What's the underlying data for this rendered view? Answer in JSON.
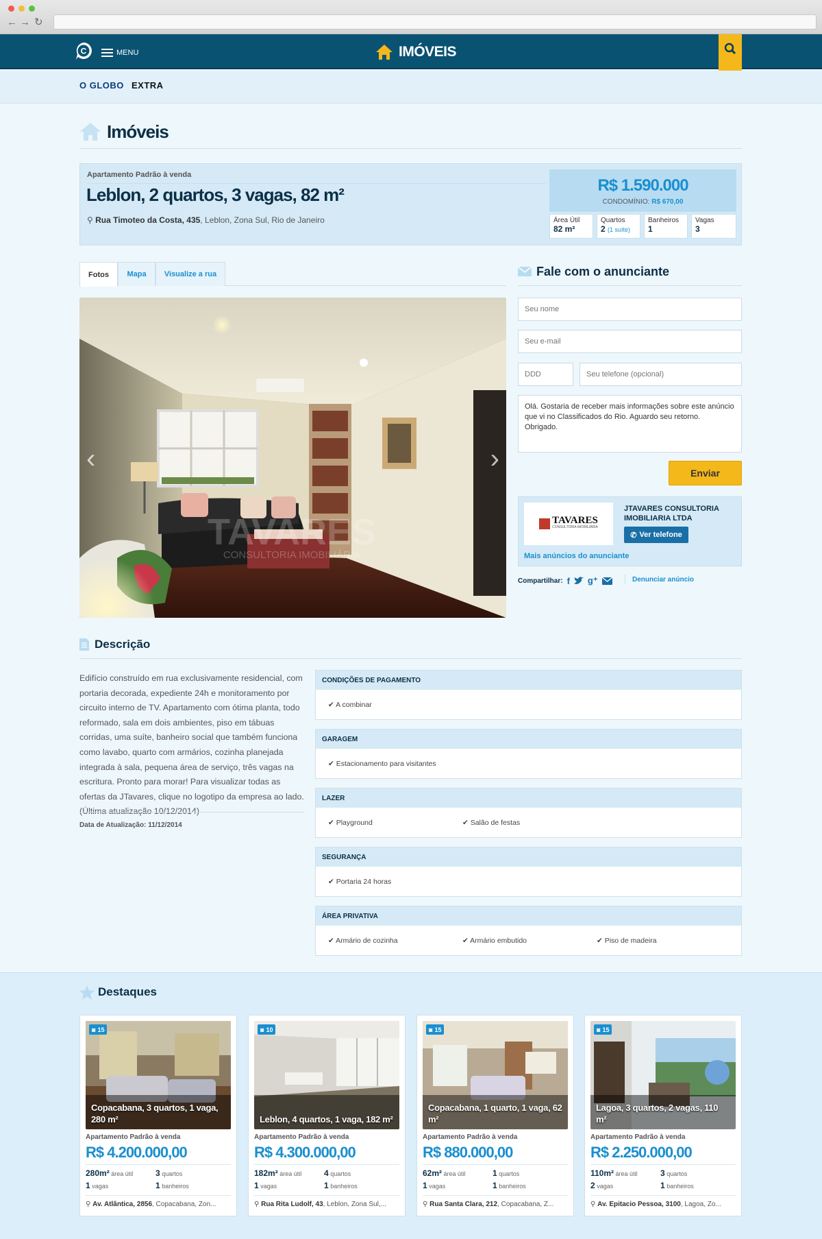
{
  "site": {
    "title": "IMÓVEIS",
    "menu_label": "MENU",
    "brands": [
      "O GLOBO",
      "EXTRA"
    ]
  },
  "section_title": "Imóveis",
  "listing": {
    "type": "Apartamento Padrão à venda",
    "title": "Leblon, 2 quartos, 3 vagas, 82 m²",
    "address_street": "Rua Timoteo da Costa, 435",
    "address_rest": ", Leblon, Zona Sul, Rio de Janeiro",
    "price": "R$ 1.590.000",
    "condo_label": "CONDOMÍNIO:",
    "condo_value": "R$ 670,00",
    "stats": [
      {
        "label": "Área Útil",
        "value": "82 m²",
        "extra": ""
      },
      {
        "label": "Quartos",
        "value": "2",
        "extra": "(1 suíte)"
      },
      {
        "label": "Banheiros",
        "value": "1",
        "extra": ""
      },
      {
        "label": "Vagas",
        "value": "3",
        "extra": ""
      }
    ]
  },
  "tabs": [
    "Fotos",
    "Mapa",
    "Visualize a rua"
  ],
  "photo": {
    "watermark_line1": "TAVARES",
    "watermark_line2": "CONSULTORIA IMOBILIÁRIA"
  },
  "contact": {
    "title": "Fale com o anunciante",
    "name_placeholder": "Seu nome",
    "email_placeholder": "Seu e-mail",
    "ddd_placeholder": "DDD",
    "phone_placeholder": "Seu telefone (opcional)",
    "message": "Olá. Gostaria de receber mais informações sobre este anúncio que vi no Classificados do Rio. Aguardo seu retorno. Obrigado.",
    "send_label": "Enviar"
  },
  "advertiser": {
    "name": "JTAVARES CONSULTORIA IMOBILIARIA LTDA",
    "logo_text": "TAVARES",
    "logo_sub": "CONSULTORIA IMOBILIÁRIA",
    "phone_label": "Ver telefone",
    "more_label": "Mais anúncios do anunciante"
  },
  "share": {
    "label": "Compartilhar:",
    "report_label": "Denunciar anúncio"
  },
  "description": {
    "title": "Descrição",
    "text": "Edifício construído em rua exclusivamente residencial, com portaria decorada, expediente 24h e monitoramento por circuito interno de TV. Apartamento com ótima planta, todo reformado, sala em dois ambientes, piso em tábuas corridas, uma suíte, banheiro social que também funciona como lavabo, quarto com armários, cozinha planejada integrada à sala, pequena área de serviço, três vagas na escritura. Pronto para morar! Para visualizar todas as ofertas da JTavares, clique no logotipo da empresa ao lado. (Última atualização 10/12/2014)",
    "updated": "Data de Atualização: 11/12/2014"
  },
  "features": [
    {
      "title": "CONDIÇÕES DE PAGAMENTO",
      "items": [
        "A combinar"
      ]
    },
    {
      "title": "GARAGEM",
      "items": [
        "Estacionamento para visitantes"
      ]
    },
    {
      "title": "LAZER",
      "items": [
        "Playground",
        "Salão de festas"
      ]
    },
    {
      "title": "SEGURANÇA",
      "items": [
        "Portaria 24 horas"
      ]
    },
    {
      "title": "ÁREA PRIVATIVA",
      "items": [
        "Armário de cozinha",
        "Armário embutido",
        "Piso de madeira"
      ]
    }
  ],
  "destaques": {
    "title": "Destaques",
    "cards": [
      {
        "photos": "15",
        "title": "Copacabana, 3 quartos, 1 vaga, 280 m²",
        "type": "Apartamento Padrão à venda",
        "price": "R$ 4.200.000,00",
        "area": "280m²",
        "area_label": "área útil",
        "rooms": "3",
        "rooms_label": "quartos",
        "spots": "1",
        "spots_label": "vagas",
        "baths": "1",
        "baths_label": "banheiros",
        "street": "Av. Atlântica, 2856",
        "rest": ", Copacabana, Zon..."
      },
      {
        "photos": "10",
        "title": "Leblon, 4 quartos, 1 vaga, 182 m²",
        "type": "Apartamento Padrão à venda",
        "price": "R$ 4.300.000,00",
        "area": "182m²",
        "area_label": "área útil",
        "rooms": "4",
        "rooms_label": "quartos",
        "spots": "1",
        "spots_label": "vagas",
        "baths": "1",
        "baths_label": "banheiros",
        "street": "Rua Rita Ludolf, 43",
        "rest": ", Leblon, Zona Sul,..."
      },
      {
        "photos": "15",
        "title": "Copacabana, 1 quarto, 1 vaga, 62 m²",
        "type": "Apartamento Padrão à venda",
        "price": "R$ 880.000,00",
        "area": "62m²",
        "area_label": "área útil",
        "rooms": "1",
        "rooms_label": "quartos",
        "spots": "1",
        "spots_label": "vagas",
        "baths": "1",
        "baths_label": "banheiros",
        "street": "Rua Santa Clara, 212",
        "rest": ", Copacabana, Z..."
      },
      {
        "photos": "15",
        "title": "Lagoa, 3 quartos, 2 vagas, 110 m²",
        "type": "Apartamento Padrão à venda",
        "price": "R$ 2.250.000,00",
        "area": "110m²",
        "area_label": "área útil",
        "rooms": "3",
        "rooms_label": "quartos",
        "spots": "2",
        "spots_label": "vagas",
        "baths": "1",
        "baths_label": "banheiros",
        "street": "Av. Epitacio Pessoa, 3100",
        "rest": ", Lagoa, Zo..."
      }
    ]
  }
}
